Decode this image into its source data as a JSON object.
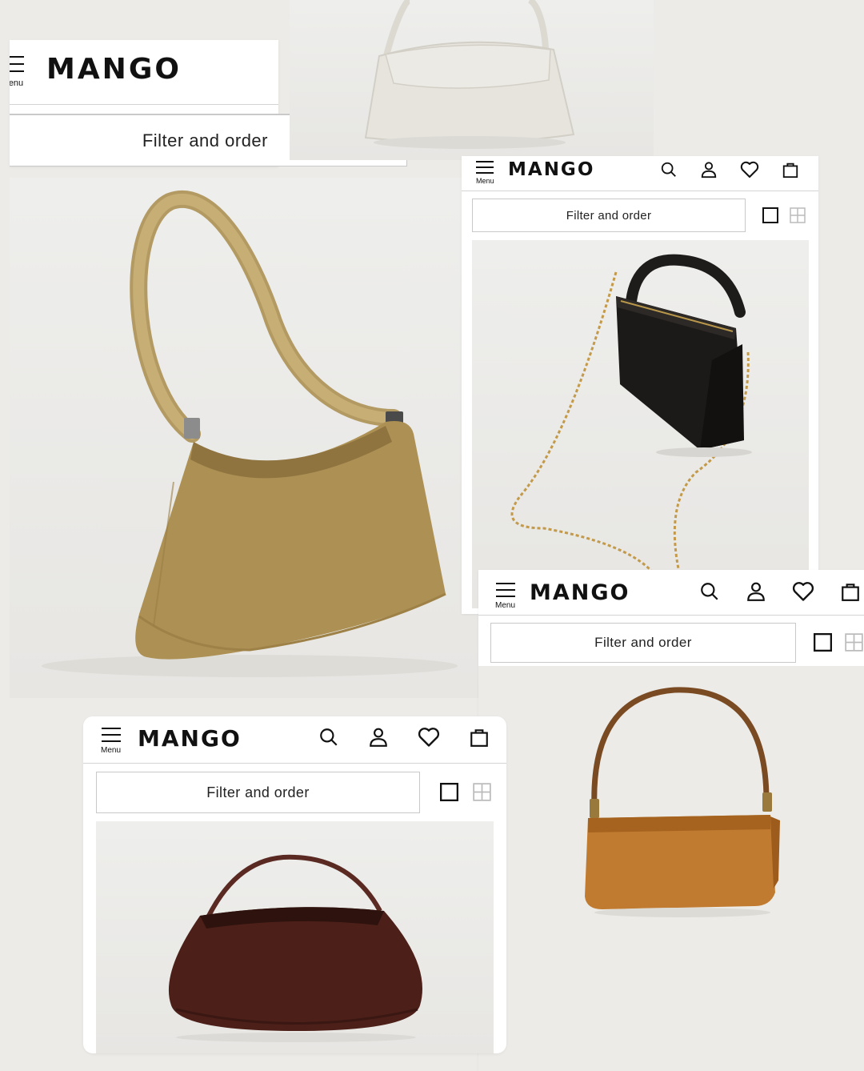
{
  "brand": {
    "logo_text": "MANGO"
  },
  "header": {
    "menu_label": "Menu",
    "menu_label_partial": "enu",
    "icons": [
      "search-icon",
      "account-icon",
      "wishlist-heart-icon",
      "shopping-bag-icon"
    ]
  },
  "filter": {
    "label": "Filter and order"
  },
  "view_toggle": {
    "options": [
      "single-column-view-icon",
      "grid-view-icon"
    ]
  },
  "products": [
    {
      "name": "white-croc-baguette-bag",
      "color": "#e6e4dd"
    },
    {
      "name": "tan-shoulder-bag",
      "color": "#ad9053"
    },
    {
      "name": "black-chain-bag",
      "color": "#1c1a18"
    },
    {
      "name": "caramel-croc-baguette-bag",
      "color": "#c17b30"
    },
    {
      "name": "burgundy-curved-handbag",
      "color": "#4c2019"
    }
  ],
  "colors": {
    "page_background": "#ecebe7",
    "card_background": "#ffffff",
    "text": "#111111",
    "border": "#c9c9c9"
  }
}
